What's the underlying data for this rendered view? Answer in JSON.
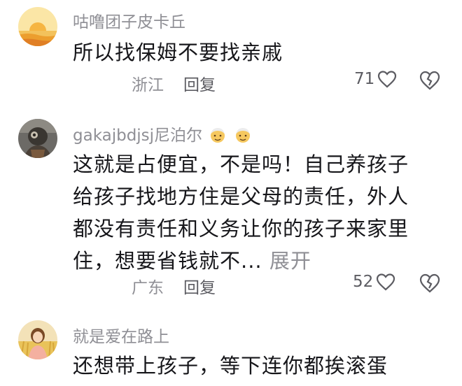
{
  "comments": [
    {
      "username": "咕噜团子皮卡丘",
      "text": "所以找保姆不要找亲戚",
      "location": "浙江",
      "reply_label": "回复",
      "likes": "71",
      "avatar": "sunset-avatar"
    },
    {
      "username": "gakajbdjsj尼泊尔",
      "badges": [
        "elder-face-emoji",
        "elder-face-emoji"
      ],
      "text_lines": [
        "这就是占便宜，不是吗！自己养孩子",
        "给孩子找地方住是父母的责任，外人",
        "都没有责任和义务让你的孩子来家里",
        "住，想要省钱就不..."
      ],
      "expand_label": "展开",
      "location": "广东",
      "reply_label": "回复",
      "likes": "52",
      "avatar": "mask-figure-avatar"
    },
    {
      "username": "就是爱在路上",
      "text": "还想带上孩子，等下连你都挨滚蛋",
      "avatar": "girl-wheat-avatar"
    }
  ],
  "colors": {
    "text": "#16161a",
    "secondary": "#8f8f95",
    "action": "#5c5c62"
  }
}
